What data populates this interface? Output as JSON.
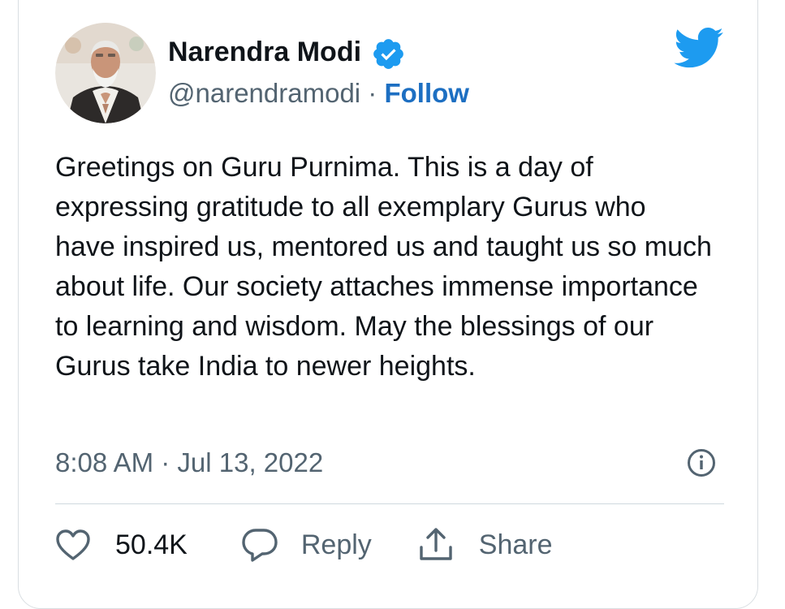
{
  "tweet": {
    "author": {
      "name": "Narendra Modi",
      "handle": "@narendramodi",
      "separator": "·",
      "follow_label": "Follow",
      "avatar_icon": "person-avatar",
      "verified_icon": "verified-badge-icon"
    },
    "text": "Greetings on Guru Purnima. This is a day of expressing gratitude to all exemplary Gurus who have inspired us, mentored us and taught us so much about life. Our society attaches immense importance to learning and wisdom. May the blessings of our Gurus take India to newer heights.",
    "timestamp": "8:08 AM · Jul 13, 2022",
    "actions": {
      "like_count": "50.4K",
      "reply_label": "Reply",
      "share_label": "Share"
    }
  },
  "colors": {
    "accent": "#1d9bf0",
    "follow": "#1d6fc2",
    "text_primary": "#0f1419",
    "text_secondary": "#536471",
    "border": "#cfd9de"
  },
  "icons": [
    "twitter-logo",
    "verified-badge-icon",
    "info-icon",
    "heart-icon",
    "reply-bubble-icon",
    "share-icon"
  ]
}
